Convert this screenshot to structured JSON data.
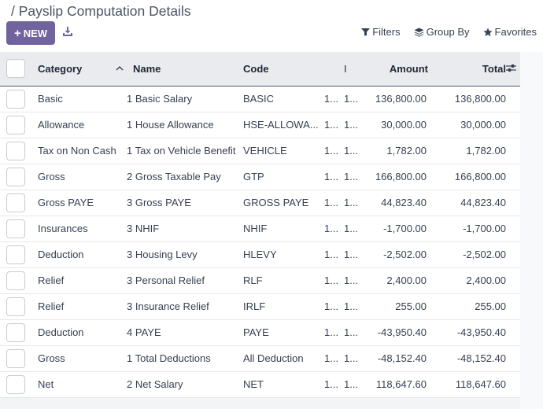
{
  "header": {
    "breadcrumb": "/ Payslip Computation Details",
    "new_button": "NEW",
    "new_icon": "plus-icon",
    "download_icon": "download-icon"
  },
  "search_tools": {
    "filters": "Filters",
    "group_by": "Group By",
    "favorites": "Favorites"
  },
  "table": {
    "columns": {
      "category": "Category",
      "name": "Name",
      "code": "Code",
      "hidden_col": "I",
      "amount": "Amount",
      "total": "Total"
    },
    "sort_indicator": "^",
    "rows": [
      {
        "category": "Basic",
        "seq": "1",
        "name": "Basic Salary",
        "code": "BASIC",
        "c1": "1...",
        "c2": "1...",
        "amount": "136,800.00",
        "total": "136,800.00"
      },
      {
        "category": "Allowance",
        "seq": "1",
        "name": "House Allowance",
        "code": "HSE-ALLOWA...",
        "c1": "1...",
        "c2": "1...",
        "amount": "30,000.00",
        "total": "30,000.00"
      },
      {
        "category": "Tax on Non Cash",
        "seq": "1",
        "name": "Tax on Vehicle Benefit",
        "code": "VEHICLE",
        "c1": "1...",
        "c2": "1...",
        "amount": "1,782.00",
        "total": "1,782.00"
      },
      {
        "category": "Gross",
        "seq": "2",
        "name": "Gross Taxable Pay",
        "code": "GTP",
        "c1": "1...",
        "c2": "1...",
        "amount": "166,800.00",
        "total": "166,800.00"
      },
      {
        "category": "Gross PAYE",
        "seq": "3",
        "name": "Gross PAYE",
        "code": "GROSS PAYE",
        "c1": "1...",
        "c2": "1...",
        "amount": "44,823.40",
        "total": "44,823.40"
      },
      {
        "category": "Insurances",
        "seq": "3",
        "name": "NHIF",
        "code": "NHIF",
        "c1": "1...",
        "c2": "1...",
        "amount": "-1,700.00",
        "total": "-1,700.00"
      },
      {
        "category": "Deduction",
        "seq": "3",
        "name": "Housing Levy",
        "code": "HLEVY",
        "c1": "1...",
        "c2": "1...",
        "amount": "-2,502.00",
        "total": "-2,502.00"
      },
      {
        "category": "Relief",
        "seq": "3",
        "name": "Personal Relief",
        "code": "RLF",
        "c1": "1...",
        "c2": "1...",
        "amount": "2,400.00",
        "total": "2,400.00"
      },
      {
        "category": "Relief",
        "seq": "3",
        "name": "Insurance Relief",
        "code": "IRLF",
        "c1": "1...",
        "c2": "1...",
        "amount": "255.00",
        "total": "255.00"
      },
      {
        "category": "Deduction",
        "seq": "4",
        "name": "PAYE",
        "code": "PAYE",
        "c1": "1...",
        "c2": "1...",
        "amount": "-43,950.40",
        "total": "-43,950.40"
      },
      {
        "category": "Gross",
        "seq": "1",
        "name": "Total Deductions",
        "code": "All Deduction",
        "c1": "1...",
        "c2": "1...",
        "amount": "-48,152.40",
        "total": "-48,152.40"
      },
      {
        "category": "Net",
        "seq": "2",
        "name": "Net Salary",
        "code": "NET",
        "c1": "1...",
        "c2": "1...",
        "amount": "118,647.60",
        "total": "118,647.60"
      }
    ]
  },
  "colors": {
    "primary": "#71639e",
    "header_bg": "#e9ebef",
    "header_border": "#5e5883"
  }
}
